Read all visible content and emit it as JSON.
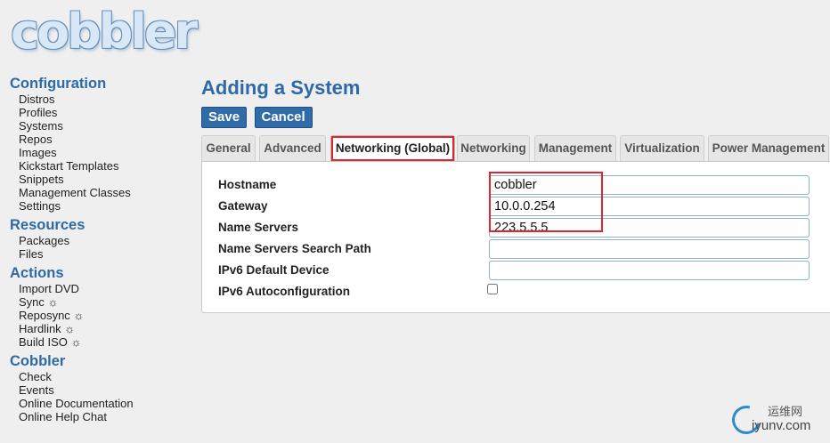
{
  "logo": {
    "text": "cobbler"
  },
  "sidebar": {
    "sections": [
      {
        "title": "Configuration",
        "items": [
          "Distros",
          "Profiles",
          "Systems",
          "Repos",
          "Images",
          "Kickstart Templates",
          "Snippets",
          "Management Classes",
          "Settings"
        ]
      },
      {
        "title": "Resources",
        "items": [
          "Packages",
          "Files"
        ]
      },
      {
        "title": "Actions",
        "items": [
          "Import DVD",
          "Sync ☼",
          "Reposync ☼",
          "Hardlink ☼",
          "Build ISO ☼"
        ]
      },
      {
        "title": "Cobbler",
        "items": [
          "Check",
          "Events",
          "Online Documentation",
          "Online Help Chat"
        ]
      }
    ]
  },
  "main": {
    "title": "Adding a System",
    "save_label": "Save",
    "cancel_label": "Cancel",
    "tabs": [
      "General",
      "Advanced",
      "Networking (Global)",
      "Networking",
      "Management",
      "Virtualization",
      "Power Management"
    ],
    "active_tab": "Networking (Global)",
    "fields": {
      "hostname": {
        "label": "Hostname",
        "value": "cobbler"
      },
      "gateway": {
        "label": "Gateway",
        "value": "10.0.0.254"
      },
      "name_servers": {
        "label": "Name Servers",
        "value": "223.5.5.5"
      },
      "search_path": {
        "label": "Name Servers Search Path",
        "value": ""
      },
      "ipv6_device": {
        "label": "IPv6 Default Device",
        "value": ""
      },
      "ipv6_autoconf": {
        "label": "IPv6 Autoconfiguration",
        "checked": false
      }
    }
  },
  "watermark": {
    "line1": "运维网",
    "line2": "iyunv.com"
  },
  "colors": {
    "accent": "#2d6aa6",
    "button": "#2f6ba8",
    "highlight": "#e0262d"
  }
}
